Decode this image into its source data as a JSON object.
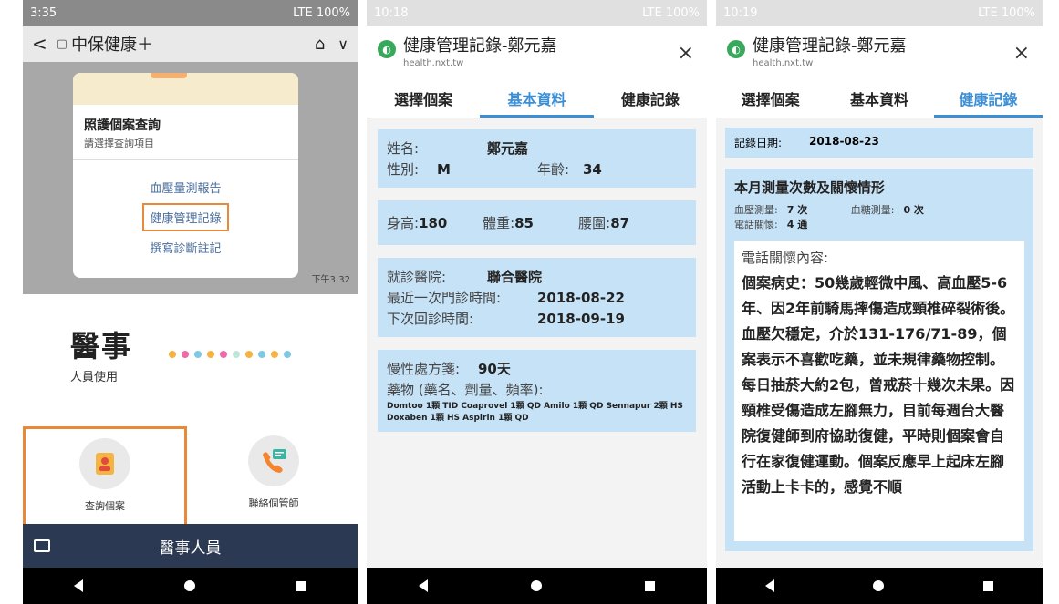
{
  "phone1": {
    "status": {
      "time": "3:35",
      "right": "LTE  100%"
    },
    "appbar": {
      "back": "<",
      "title": "中保健康＋",
      "home": "⌂",
      "chev": "∨"
    },
    "card": {
      "title": "照護個案查詢",
      "subtitle": "請選擇查詢項目",
      "options": [
        "血壓量測報告",
        "健康管理記錄",
        "撰寫診斷註記"
      ],
      "time": "下午3:32"
    },
    "brand": {
      "big": "醫事",
      "small": "人員使用"
    },
    "dot_colors": [
      "#f5b342",
      "#f06aa8",
      "#7ec8e3",
      "#f5b342",
      "#f06aa8",
      "#bfe6d6",
      "#f5b342",
      "#7ec8e3",
      "#f5b342",
      "#7ec8e3"
    ],
    "menu": [
      {
        "label": "查詢個案"
      },
      {
        "label": "聯絡個管師"
      }
    ],
    "bottombar": {
      "label": "醫事人員"
    }
  },
  "phone2": {
    "status": {
      "time": "10:18",
      "right": "LTE  100%"
    },
    "header": {
      "title": "健康管理記錄-鄭元嘉",
      "url": "health.nxt.tw",
      "close": "×"
    },
    "tabs": [
      "選擇個案",
      "基本資料",
      "健康記錄"
    ],
    "active_tab": 1,
    "basic": {
      "name_label": "姓名:",
      "name": "鄭元嘉",
      "sex_label": "性別:",
      "sex": "M",
      "age_label": "年齡:",
      "age": "34"
    },
    "body": {
      "height_label": "身高:",
      "height": "180",
      "weight_label": "體重:",
      "weight": "85",
      "waist_label": "腰圍:",
      "waist": "87"
    },
    "visit": {
      "hospital_label": "就診醫院:",
      "hospital": "聯合醫院",
      "last_label": "最近一次門診時間:",
      "last": "2018-08-22",
      "next_label": "下次回診時間:",
      "next": "2018-09-19"
    },
    "meds": {
      "chronic_label": "慢性處方箋:",
      "chronic": "90天",
      "drugs_label": "藥物 (藥名、劑量、頻率):",
      "drugs": "Domtoo 1顆 TID Coaprovel 1顆 QD Amilo 1顆 QD Sennapur 2顆 HS Doxaben 1顆 HS Aspirin 1顆 QD"
    }
  },
  "phone3": {
    "status": {
      "time": "10:19",
      "right": "LTE  100%"
    },
    "header": {
      "title": "健康管理記錄-鄭元嘉",
      "url": "health.nxt.tw",
      "close": "×"
    },
    "tabs": [
      "選擇個案",
      "基本資料",
      "健康記錄"
    ],
    "active_tab": 2,
    "date_label": "記錄日期:",
    "date": "2018-08-23",
    "section_title": "本月測量次數及關懷情形",
    "bp_label": "血壓測量:",
    "bp": "7 次",
    "sugar_label": "血糖測量:",
    "sugar": "0 次",
    "call_label": "電話關懷:",
    "call": "4 通",
    "care_label": "電話關懷內容:",
    "care_text": "個案病史：50幾歲輕微中風、高血壓5-6年、因2年前騎馬摔傷造成頸椎碎裂術後。血壓欠穩定，介於131-176/71-89，個案表示不喜歡吃藥，並未規律藥物控制。每日抽菸大約2包，曾戒菸十幾次未果。因頸椎受傷造成左腳無力，目前每週台大醫院復健師到府協助復健，平時則個案會自行在家復健運動。個案反應早上起床左腳活動上卡卡的，感覺不順"
  }
}
